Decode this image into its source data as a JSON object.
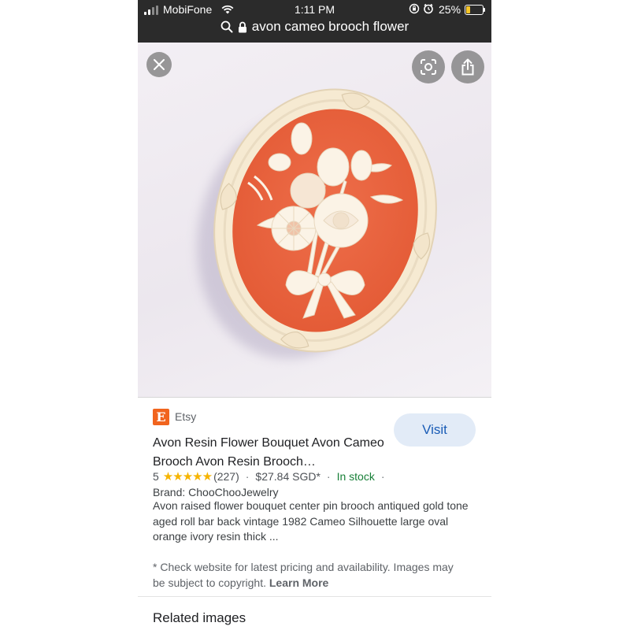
{
  "status_bar": {
    "carrier": "MobiFone",
    "time": "1:11 PM",
    "battery": "25%",
    "battery_level": 0.25,
    "battery_color": "#f7c628"
  },
  "url_bar": {
    "query": "avon cameo brooch flower",
    "icons": [
      "search-icon",
      "lock-icon"
    ]
  },
  "viewer": {
    "close_icon": "close-icon",
    "lens_icon": "lens-icon",
    "share_icon": "share-icon"
  },
  "result": {
    "source_logo_letter": "E",
    "source_name": "Etsy",
    "source_color": "#f1641e",
    "visit_label": "Visit",
    "title": "Avon Resin Flower Bouquet Avon Cameo Brooch Avon Resin Brooch…",
    "rating": "5",
    "rating_stars": 5,
    "reviews": "(227)",
    "price": "$27.84 SGD*",
    "availability": "In stock",
    "brand": "Brand: ChooChooJewelry",
    "description": "Avon raised flower bouquet center pin brooch antiqued gold tone aged roll bar back vintage 1982 Cameo Silhouette large oval orange ivory resin thick ...",
    "note": "* Check website for latest pricing and availability. Images may be subject to copyright.",
    "learn_more": "Learn More"
  },
  "related": {
    "heading": "Related images"
  },
  "colors": {
    "top_bar": "#2b2b2b",
    "visit_bg": "#e2ebf7",
    "visit_text": "#1a5cb6",
    "in_stock": "#188038",
    "star": "#f6b400"
  }
}
